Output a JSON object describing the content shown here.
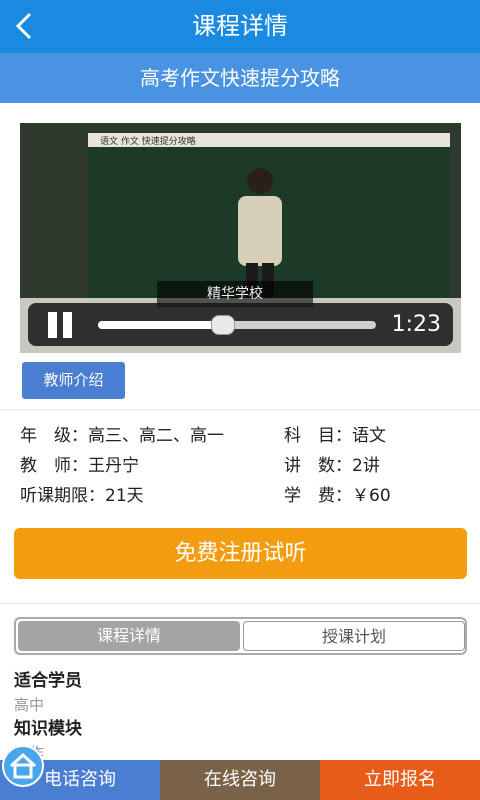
{
  "header": {
    "title": "课程详情",
    "back_icon": "chevron-left-icon"
  },
  "course": {
    "title": "高考作文快速提分攻略"
  },
  "video": {
    "board_text": "语文 作文 快速提分攻略",
    "watermark": "精华学校",
    "time": "1:23",
    "progress": 0.45,
    "pause_icon": "pause-icon"
  },
  "teacher_button": "教师介绍",
  "info": {
    "grade_label": "年　级：",
    "grade_value": "高三、高二、高一",
    "subject_label": "科　目：",
    "subject_value": "语文",
    "teacher_label": "教　师：",
    "teacher_value": "王丹宁",
    "lectures_label": "讲　数：",
    "lectures_value": "2讲",
    "period_label": "听课期限：",
    "period_value": "21天",
    "fee_label": "学　费：",
    "fee_value": "￥60"
  },
  "trial_button": "免费注册试听",
  "tabs": [
    {
      "label": "课程详情",
      "active": true
    },
    {
      "label": "授课计划",
      "active": false
    }
  ],
  "detail": {
    "h1": "适合学员",
    "v1": "高中",
    "h2": "知识模块",
    "v2": "写作"
  },
  "bottombar": {
    "call": "电话咨询",
    "online": "在线咨询",
    "signup": "立即报名"
  },
  "colors": {
    "header": "#1a8ae0",
    "subheader": "#4a93e3",
    "accent_orange": "#f39c10",
    "call_bg": "#4a7ed2",
    "online_bg": "#7a6249",
    "signup_bg": "#e85c1a"
  },
  "home_icon": "home-icon"
}
